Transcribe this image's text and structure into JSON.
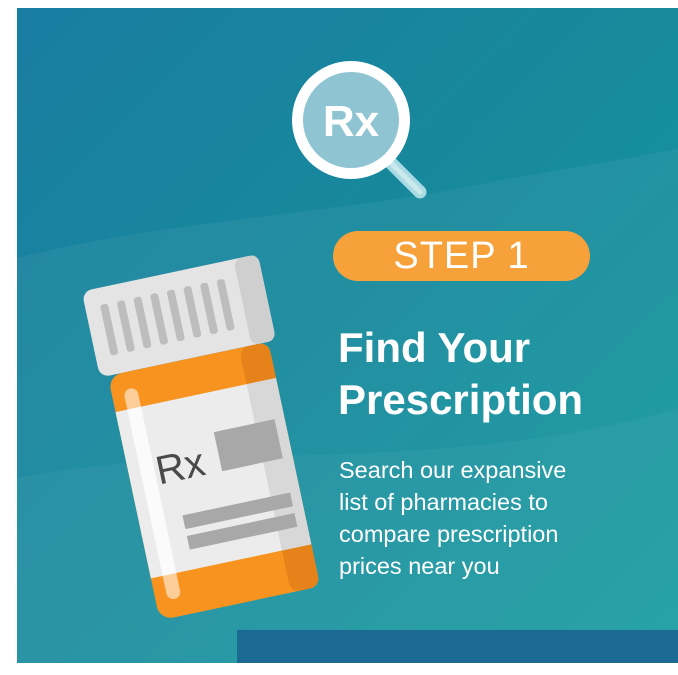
{
  "colors": {
    "background_start": "#1a7da2",
    "background_end": "#159b9f",
    "accent_orange": "#f7a13a",
    "bottom_bar": "#1a6a93",
    "text": "#ffffff"
  },
  "icons": {
    "search": "rx-magnifying-glass-icon",
    "bottle": "prescription-bottle-icon"
  },
  "search_icon_label": "Rx",
  "bottle_label": "Rx",
  "step": {
    "label": "STEP 1"
  },
  "title": {
    "line1": "Find Your",
    "line2": "Prescription"
  },
  "description": {
    "line1": "Search our expansive",
    "line2": "list of pharmacies to",
    "line3": "compare prescription",
    "line4": "prices near you"
  }
}
